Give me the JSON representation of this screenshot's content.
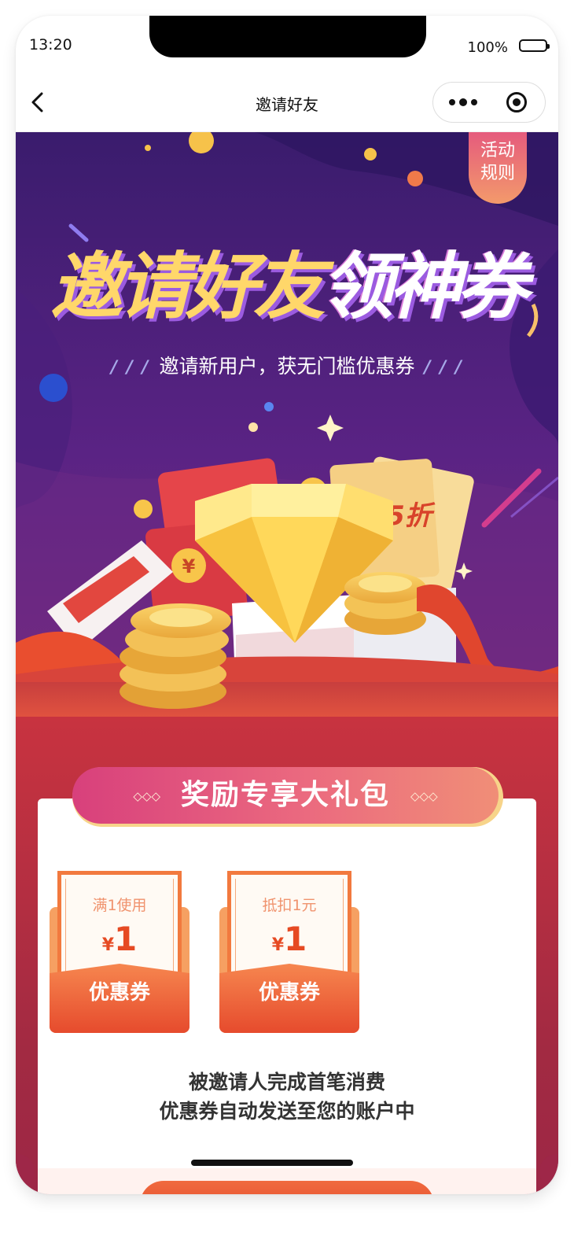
{
  "status_bar": {
    "time": "13:20",
    "battery": "100%"
  },
  "nav": {
    "title": "邀请好友"
  },
  "hero": {
    "rules_button": "活动\n规则",
    "headline_part1": "邀请好友",
    "headline_part2": "领神券",
    "subtitle": "邀请新用户，获无门槛优惠券",
    "discount_tag": "5折",
    "coin_symbol": "¥"
  },
  "gift_section": {
    "banner": "奖励专享大礼包",
    "coupons": [
      {
        "condition": "满1使用",
        "currency": "¥",
        "amount": "1",
        "label": "优惠券"
      },
      {
        "condition": "抵扣1元",
        "currency": "¥",
        "amount": "1",
        "label": "优惠券"
      }
    ],
    "description_line1": "被邀请人完成首笔消费",
    "description_line2": "优惠券自动发送至您的账户中"
  },
  "colors": {
    "hero_bg": "#3a1f6e",
    "section_bg": "#a82b43",
    "accent": "#e64b2d",
    "gold": "#ffd76a"
  }
}
